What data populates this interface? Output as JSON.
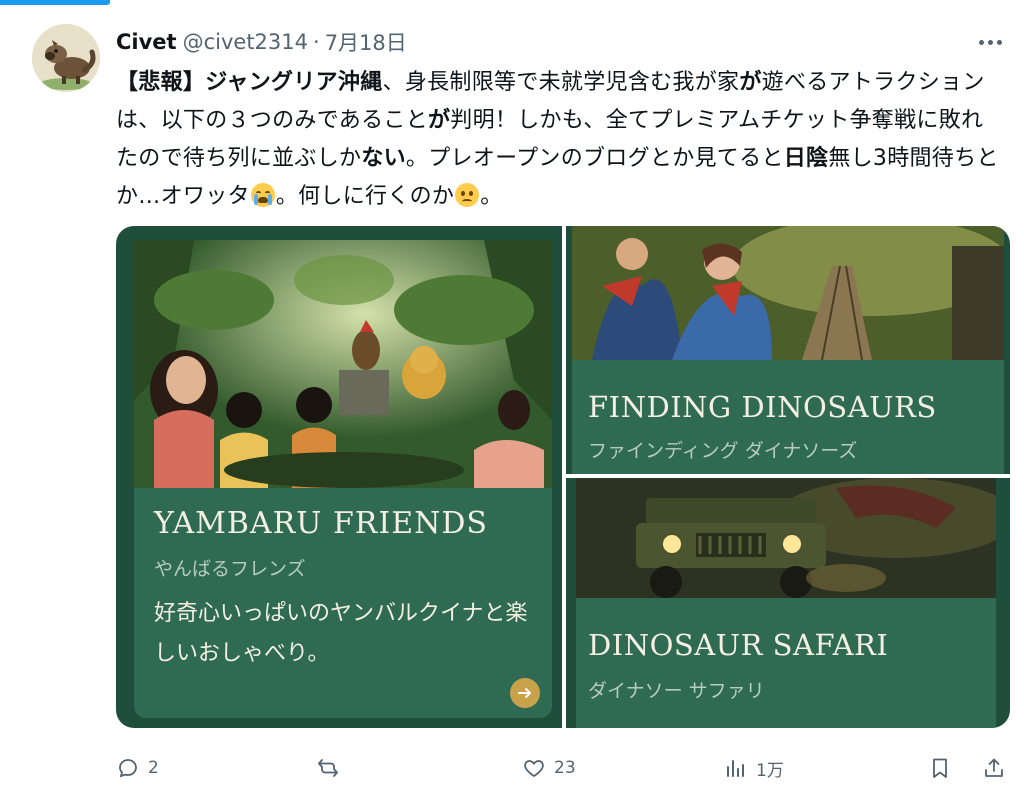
{
  "author": {
    "name": "Civet",
    "handle": "@civet2314",
    "date": "7月18日",
    "separator": "·"
  },
  "tweet": {
    "segments": [
      {
        "text": "【悲報】",
        "bold": true
      },
      {
        "text": "ジャングリア沖縄",
        "bold": true
      },
      {
        "text": "、身長制限等で未就学児含む我が家",
        "bold": false
      },
      {
        "text": "が",
        "bold": true
      },
      {
        "text": "遊べるアトラクションは、以下の３つのみであること",
        "bold": false
      },
      {
        "text": "が",
        "bold": true
      },
      {
        "text": "判明！しかも、全てプレミアムチケット争奪戦に敗れたので待ち列に並ぶしか",
        "bold": false
      },
      {
        "text": "ない",
        "bold": true
      },
      {
        "text": "。プレオープンのブログとか見てると",
        "bold": false
      },
      {
        "text": "日陰",
        "bold": true
      },
      {
        "text": "無し3時間待ちとか…オワッタ",
        "bold": false
      },
      {
        "emoji": "loudly-crying-face"
      },
      {
        "text": "。何しに行くのか",
        "bold": false
      },
      {
        "emoji": "frowning-face"
      },
      {
        "text": "。",
        "bold": false
      }
    ]
  },
  "media": {
    "left": {
      "title": "YAMBARU FRIENDS",
      "subtitle": "やんばるフレンズ",
      "description": "好奇心いっぱいのヤンバルクイナと楽しいおしゃべり。",
      "arrow_icon": "arrow-right-icon"
    },
    "right_top": {
      "title": "FINDING DINOSAURS",
      "subtitle": "ファインディング ダイナソーズ"
    },
    "right_bottom": {
      "title": "DINOSAUR SAFARI",
      "subtitle": "ダイナソー サファリ"
    }
  },
  "actions": {
    "reply": {
      "icon": "reply-icon",
      "count": "2"
    },
    "retweet": {
      "icon": "retweet-icon",
      "count": ""
    },
    "like": {
      "icon": "heart-icon",
      "count": "23"
    },
    "views": {
      "icon": "views-icon",
      "count": "1万"
    },
    "bookmark": {
      "icon": "bookmark-icon"
    },
    "share": {
      "icon": "share-icon"
    }
  },
  "colors": {
    "text": "#0f1419",
    "muted": "#536471",
    "panel_dark": "#1f4e3c",
    "panel_card": "#2f6b52",
    "accent_gold": "#c8a24a"
  }
}
